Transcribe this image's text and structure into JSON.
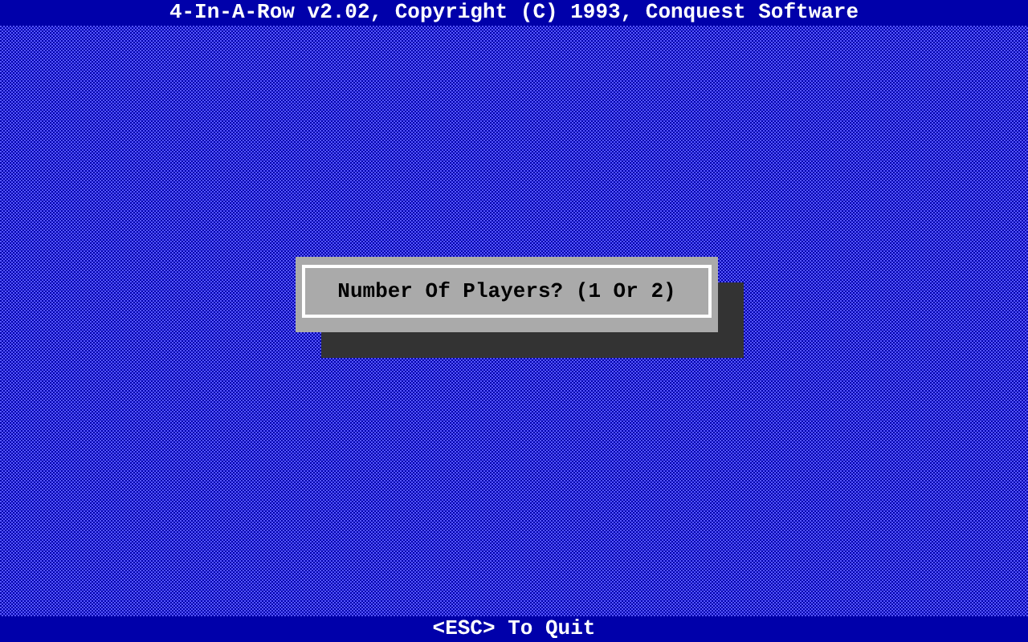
{
  "title_bar": {
    "title": "4-In-A-Row v2.02, Copyright (C) 1993, Conquest Software"
  },
  "dialog": {
    "prompt": "Number Of Players? (1 Or 2)"
  },
  "status_bar": {
    "hint": "<ESC> To Quit"
  }
}
